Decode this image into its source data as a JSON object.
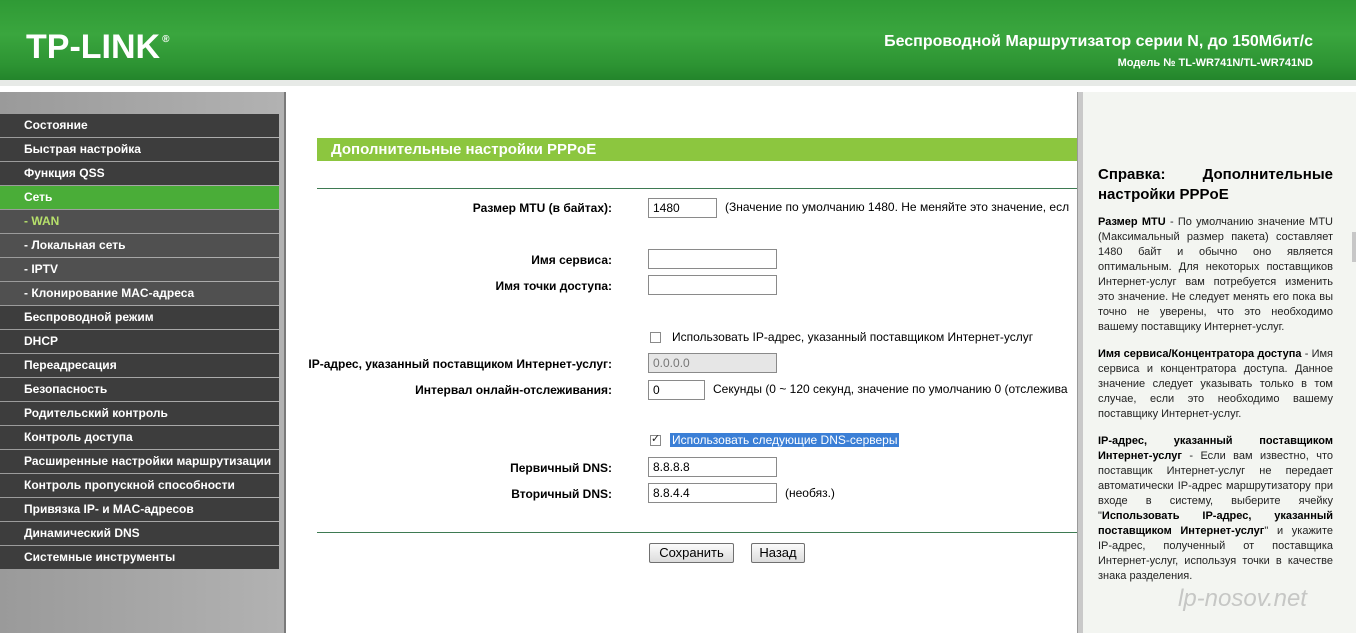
{
  "header": {
    "logo": "TP-LINK",
    "logo_mark": "®",
    "title": "Беспроводной Маршрутизатор серии N, до 150Мбит/с",
    "model": "Модель № TL-WR741N/TL-WR741ND"
  },
  "sidebar": {
    "items": [
      {
        "label": "Состояние"
      },
      {
        "label": "Быстрая настройка"
      },
      {
        "label": "Функция QSS"
      },
      {
        "label": "Сеть"
      },
      {
        "label": "- WAN"
      },
      {
        "label": "- Локальная сеть"
      },
      {
        "label": "- IPTV"
      },
      {
        "label": "- Клонирование MAC-адреса"
      },
      {
        "label": "Беспроводной режим"
      },
      {
        "label": "DHCP"
      },
      {
        "label": "Переадресация"
      },
      {
        "label": "Безопасность"
      },
      {
        "label": "Родительский контроль"
      },
      {
        "label": "Контроль доступа"
      },
      {
        "label": "Расширенные настройки маршрутизации"
      },
      {
        "label": "Контроль пропускной способности"
      },
      {
        "label": "Привязка IP- и MAC-адресов"
      },
      {
        "label": "Динамический DNS"
      },
      {
        "label": "Системные инструменты"
      }
    ]
  },
  "main": {
    "title": "Дополнительные настройки PPPoE",
    "mtu": {
      "label": "Размер MTU (в байтах):",
      "value": "1480",
      "note": "(Значение по умолчанию 1480. Не меняйте это значение, есл"
    },
    "service": {
      "label": "Имя сервиса:",
      "value": ""
    },
    "access_point": {
      "label": "Имя точки доступа:",
      "value": ""
    },
    "use_isp_ip": {
      "label": "Использовать IP-адрес, указанный поставщиком Интернет-услуг",
      "checked": false
    },
    "isp_ip": {
      "label": "IP-адрес, указанный поставщиком Интернет-услуг:",
      "value": "0.0.0.0"
    },
    "echo_interval": {
      "label": "Интервал онлайн-отслеживания:",
      "value": "0",
      "note": "Секунды (0 ~ 120 секунд, значение по умолчанию 0 (отслежива"
    },
    "use_dns": {
      "label": "Использовать следующие DNS-серверы",
      "checked": true
    },
    "primary_dns": {
      "label": "Первичный DNS:",
      "value": "8.8.8.8"
    },
    "secondary_dns": {
      "label": "Вторичный DNS:",
      "value": "8.8.4.4",
      "note": "(необяз.)"
    },
    "save_label": "Сохранить",
    "back_label": "Назад"
  },
  "help": {
    "title": "Справка: Дополнительные настройки PPPoE",
    "p1_term": "Размер MTU",
    "p1_text": " - По умолчанию значение MTU (Максимальный размер пакета) составляет 1480 байт и обычно оно является оптимальным. Для некоторых поставщиков Интернет-услуг вам потребуется изменить это значение. Не следует менять его пока вы точно не уверены, что это необходимо вашему поставщику Интернет-услуг.",
    "p2_term": "Имя сервиса/Концентратора доступа",
    "p2_text": " - Имя сервиса и концентратора доступа. Данное значение следует указывать только в том случае, если это необходимо вашему поставщику Интернет-услуг.",
    "p3_term": "IP-адрес, указанный поставщиком Интернет-услуг",
    "p3_text1": " - Если вам известно, что поставщик Интернет-услуг не передает автоматически IP-адрес маршрутизатору при входе в систему, выберите ячейку \"",
    "p3_term2": "Использовать IP-адрес, указанный поставщиком Интернет-услуг",
    "p3_text2": "\" и укажите IP-адрес, полученный от поставщика Интернет-услуг, используя точки в качестве знака разделения."
  },
  "watermark": "lp-nosov.net",
  "colors": {
    "header_green": "#2f9a35",
    "menu_active": "#4aad38",
    "menu_bg": "#3d3d3d",
    "section_title": "#8cc63f",
    "selection": "#3b7fd6"
  }
}
